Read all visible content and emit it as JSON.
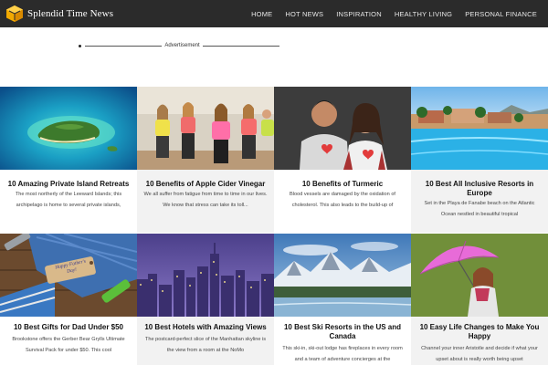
{
  "header": {
    "brand": "Splendid Time News",
    "nav": [
      {
        "label": "HOME"
      },
      {
        "label": "HOT NEWS"
      },
      {
        "label": "INSPIRATION"
      },
      {
        "label": "HEALTHY LIVING"
      },
      {
        "label": "PERSONAL FINANCE"
      }
    ]
  },
  "ad": {
    "label": "Advertisement"
  },
  "cards": [
    {
      "title": "10 Amazing Private Island Retreats",
      "excerpt": "The most northerly of the Leeward Islands; this archipelago is home to several private islands,"
    },
    {
      "title": "10 Benefits of Apple Cider Vinegar",
      "excerpt": "We all suffer from fatigue from time to time in our lives. We know that stress can take its toll..."
    },
    {
      "title": "10 Benefits of Turmeric",
      "excerpt": "Blood vessels are damaged by the oxidation of cholesterol. This also leads to the build-up of"
    },
    {
      "title": "10 Best All Inclusive Resorts in Europe",
      "excerpt": "Set in the Playa de Fanabe beach on the Atlantic Ocean nestled in beautiful tropical"
    },
    {
      "title": "10 Best Gifts for Dad Under $50",
      "excerpt": "Brookstone offers the Gerber Bear Grylls Ultimate Survival Pack for under $50. This cool"
    },
    {
      "title": "10 Best Hotels with Amazing Views",
      "excerpt": "The postcard-perfect slice of the Manhattan skyline is the view from a room at the NoMo"
    },
    {
      "title": "10 Best Ski Resorts in the US and Canada",
      "excerpt": "This ski-in, ski-out lodge has fireplaces in every room and a team of adventure concierges at the"
    },
    {
      "title": "10 Easy Life Changes to Make You Happy",
      "excerpt": "Channel your inner Aristotle and decide if what your upset about is really worth being upset"
    }
  ],
  "gift_tag": "Happy Father's Day!"
}
